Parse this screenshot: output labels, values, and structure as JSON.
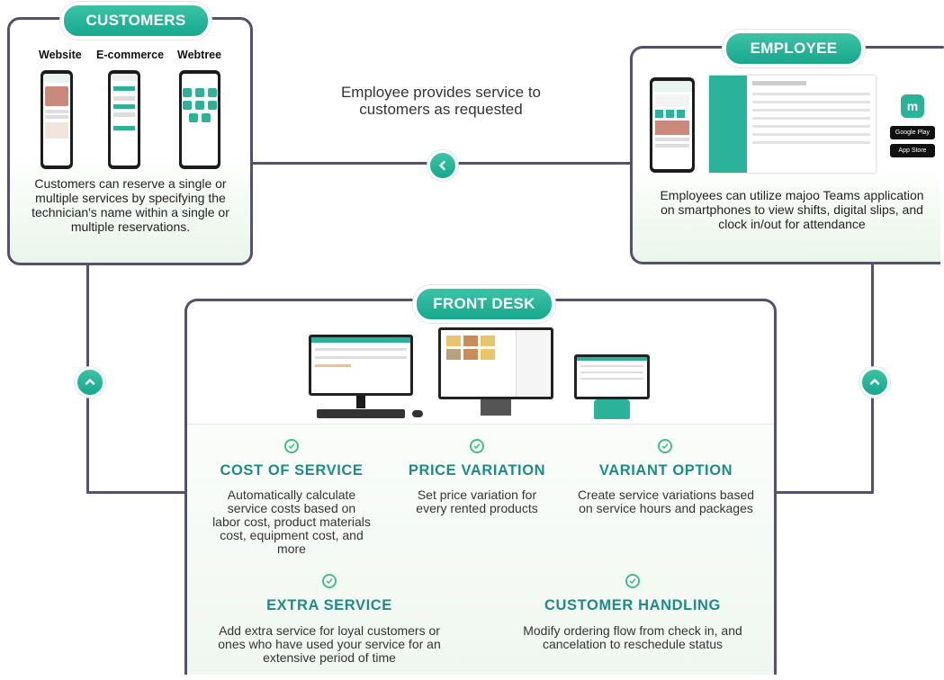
{
  "customers": {
    "badge": "CUSTOMERS",
    "channels": [
      "Website",
      "E-commerce",
      "Webtree"
    ],
    "description": "Customers can reserve a single or multiple services by specifying the technician's name within a single or multiple reservations."
  },
  "connector": {
    "caption": "Employee provides service to customers as requested"
  },
  "employee": {
    "badge": "EMPLOYEE",
    "app_name": "majoo",
    "stores": [
      "Google Play",
      "App Store"
    ],
    "description": "Employees can utilize majoo Teams application on smartphones to view shifts, digital slips, and clock in/out for attendance"
  },
  "front_desk": {
    "badge": "FRONT DESK",
    "features": [
      {
        "title": "COST OF SERVICE",
        "description": "Automatically calculate service costs based on labor cost, product materials cost, equipment cost, and more"
      },
      {
        "title": "PRICE VARIATION",
        "description": "Set price variation for every rented products"
      },
      {
        "title": "VARIANT OPTION",
        "description": "Create service variations based on service hours and packages"
      },
      {
        "title": "EXTRA SERVICE",
        "description": "Add extra service for loyal customers or ones who have used your service for an extensive period of time"
      },
      {
        "title": "CUSTOMER HANDLING",
        "description": "Modify ordering flow from check in, and cancelation to reschedule status"
      }
    ]
  },
  "colors": {
    "accent": "#1fae94",
    "title": "#1d8c86",
    "border": "#55506b"
  }
}
